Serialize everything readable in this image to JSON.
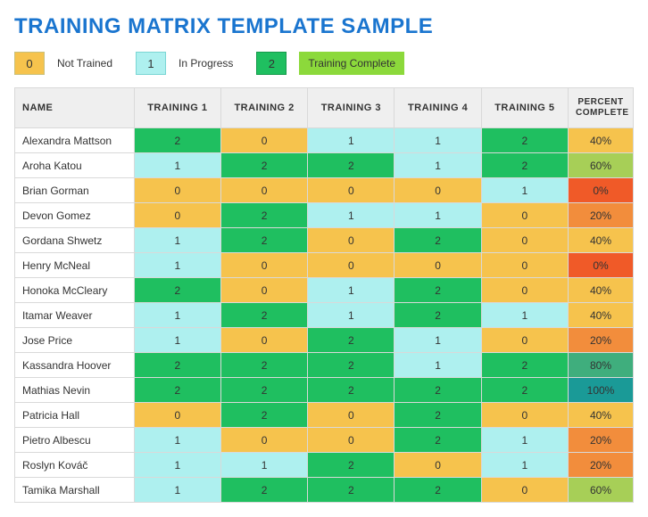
{
  "title": "TRAINING MATRIX TEMPLATE SAMPLE",
  "legend": [
    {
      "value": "0",
      "label": "Not Trained",
      "boxClass": "lb-orange"
    },
    {
      "value": "1",
      "label": "In Progress",
      "boxClass": "lb-cyan"
    },
    {
      "value": "2",
      "label": "Training Complete",
      "boxClass": "lb-green lb-lime"
    }
  ],
  "columns": {
    "name": "NAME",
    "t1": "TRAINING 1",
    "t2": "TRAINING 2",
    "t3": "TRAINING 3",
    "t4": "TRAINING 4",
    "t5": "TRAINING 5",
    "pct": "PERCENT COMPLETE"
  },
  "colors": {
    "not_trained": "#f6c34d",
    "in_progress": "#aef0ef",
    "complete": "#1fbf60",
    "pct": {
      "0": "#f05a28",
      "20": "#f28d3c",
      "40": "#f6c34d",
      "60": "#a7cf57",
      "80": "#3fae7d",
      "100": "#1a9a97"
    }
  },
  "rows": [
    {
      "name": "Alexandra Mattson",
      "t": [
        2,
        0,
        1,
        1,
        2
      ],
      "pct": "40%"
    },
    {
      "name": "Aroha Katou",
      "t": [
        1,
        2,
        2,
        1,
        2
      ],
      "pct": "60%"
    },
    {
      "name": "Brian Gorman",
      "t": [
        0,
        0,
        0,
        0,
        1
      ],
      "pct": "0%"
    },
    {
      "name": "Devon Gomez",
      "t": [
        0,
        2,
        1,
        1,
        0
      ],
      "pct": "20%"
    },
    {
      "name": "Gordana Shwetz",
      "t": [
        1,
        2,
        0,
        2,
        0
      ],
      "pct": "40%"
    },
    {
      "name": "Henry McNeal",
      "t": [
        1,
        0,
        0,
        0,
        0
      ],
      "pct": "0%"
    },
    {
      "name": "Honoka McCleary",
      "t": [
        2,
        0,
        1,
        2,
        0
      ],
      "pct": "40%"
    },
    {
      "name": "Itamar Weaver",
      "t": [
        1,
        2,
        1,
        2,
        1
      ],
      "pct": "40%"
    },
    {
      "name": "Jose Price",
      "t": [
        1,
        0,
        2,
        1,
        0
      ],
      "pct": "20%"
    },
    {
      "name": "Kassandra Hoover",
      "t": [
        2,
        2,
        2,
        1,
        2
      ],
      "pct": "80%"
    },
    {
      "name": "Mathias Nevin",
      "t": [
        2,
        2,
        2,
        2,
        2
      ],
      "pct": "100%"
    },
    {
      "name": "Patricia Hall",
      "t": [
        0,
        2,
        0,
        2,
        0
      ],
      "pct": "40%"
    },
    {
      "name": "Pietro Albescu",
      "t": [
        1,
        0,
        0,
        2,
        1
      ],
      "pct": "20%"
    },
    {
      "name": "Roslyn Kováč",
      "t": [
        1,
        1,
        2,
        0,
        1
      ],
      "pct": "20%"
    },
    {
      "name": "Tamika Marshall",
      "t": [
        1,
        2,
        2,
        2,
        0
      ],
      "pct": "60%"
    }
  ],
  "chart_data": {
    "type": "table",
    "title": "Training Matrix Template Sample",
    "legend_values": {
      "0": "Not Trained",
      "1": "In Progress",
      "2": "Training Complete"
    },
    "percent_complete_rule": "percent of trainings with value 2 (complete) out of 5",
    "columns": [
      "NAME",
      "TRAINING 1",
      "TRAINING 2",
      "TRAINING 3",
      "TRAINING 4",
      "TRAINING 5",
      "PERCENT COMPLETE"
    ],
    "rows": [
      [
        "Alexandra Mattson",
        2,
        0,
        1,
        1,
        2,
        "40%"
      ],
      [
        "Aroha Katou",
        1,
        2,
        2,
        1,
        2,
        "60%"
      ],
      [
        "Brian Gorman",
        0,
        0,
        0,
        0,
        1,
        "0%"
      ],
      [
        "Devon Gomez",
        0,
        2,
        1,
        1,
        0,
        "20%"
      ],
      [
        "Gordana Shwetz",
        1,
        2,
        0,
        2,
        0,
        "40%"
      ],
      [
        "Henry McNeal",
        1,
        0,
        0,
        0,
        0,
        "0%"
      ],
      [
        "Honoka McCleary",
        2,
        0,
        1,
        2,
        0,
        "40%"
      ],
      [
        "Itamar Weaver",
        1,
        2,
        1,
        2,
        1,
        "40%"
      ],
      [
        "Jose Price",
        1,
        0,
        2,
        1,
        0,
        "20%"
      ],
      [
        "Kassandra Hoover",
        2,
        2,
        2,
        1,
        2,
        "80%"
      ],
      [
        "Mathias Nevin",
        2,
        2,
        2,
        2,
        2,
        "100%"
      ],
      [
        "Patricia Hall",
        0,
        2,
        0,
        2,
        0,
        "40%"
      ],
      [
        "Pietro Albescu",
        1,
        0,
        0,
        2,
        1,
        "20%"
      ],
      [
        "Roslyn Kováč",
        1,
        1,
        2,
        0,
        1,
        "20%"
      ],
      [
        "Tamika Marshall",
        1,
        2,
        2,
        2,
        0,
        "60%"
      ]
    ]
  }
}
